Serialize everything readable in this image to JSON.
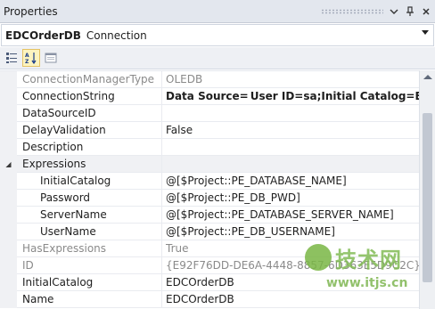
{
  "window": {
    "title": "Properties"
  },
  "selector": {
    "object_name": "EDCOrderDB",
    "object_type": "Connection"
  },
  "properties": [
    {
      "name": "ConnectionManagerType",
      "value": "OLEDB",
      "readonly": true,
      "bold": false,
      "sub": false
    },
    {
      "name": "ConnectionString",
      "value": "Data Source=",
      "value_suffix": "User ID=sa;Initial Catalog=EDCOrderDB",
      "redacted": true,
      "bold": true,
      "readonly": false,
      "sub": false
    },
    {
      "name": "DataSourceID",
      "value": "",
      "readonly": false,
      "bold": false,
      "sub": false
    },
    {
      "name": "DelayValidation",
      "value": "False",
      "readonly": false,
      "bold": false,
      "sub": false
    },
    {
      "name": "Description",
      "value": "",
      "readonly": false,
      "bold": false,
      "sub": false
    },
    {
      "name": "Expressions",
      "value": "",
      "category": true,
      "expanded": true,
      "readonly": false,
      "bold": false,
      "sub": false
    },
    {
      "name": "InitialCatalog",
      "value": "@[$Project::PE_DATABASE_NAME]",
      "readonly": false,
      "bold": false,
      "sub": true
    },
    {
      "name": "Password",
      "value": "@[$Project::PE_DB_PWD]",
      "readonly": false,
      "bold": false,
      "sub": true
    },
    {
      "name": "ServerName",
      "value": "@[$Project::PE_DATABASE_SERVER_NAME]",
      "readonly": false,
      "bold": false,
      "sub": true
    },
    {
      "name": "UserName",
      "value": "@[$Project::PE_DB_USERNAME]",
      "readonly": false,
      "bold": false,
      "sub": true
    },
    {
      "name": "HasExpressions",
      "value": "True",
      "readonly": true,
      "bold": false,
      "sub": false
    },
    {
      "name": "ID",
      "value": "{E92F76DD-DE6A-4448-8857-6D363E5D9C2C}",
      "readonly": true,
      "bold": false,
      "sub": false
    },
    {
      "name": "InitialCatalog",
      "value": "EDCOrderDB",
      "readonly": false,
      "bold": false,
      "sub": false
    },
    {
      "name": "Name",
      "value": "EDCOrderDB",
      "readonly": false,
      "bold": false,
      "sub": false
    }
  ],
  "watermark": {
    "cn_text": "技术网",
    "url_text": "www.itjs.cn"
  },
  "icons": [
    "pin-icon",
    "close-icon",
    "categorized-icon",
    "alphabetical-icon",
    "property-pages-icon",
    "dropdown-arrow-icon",
    "expand-collapse-icon"
  ]
}
